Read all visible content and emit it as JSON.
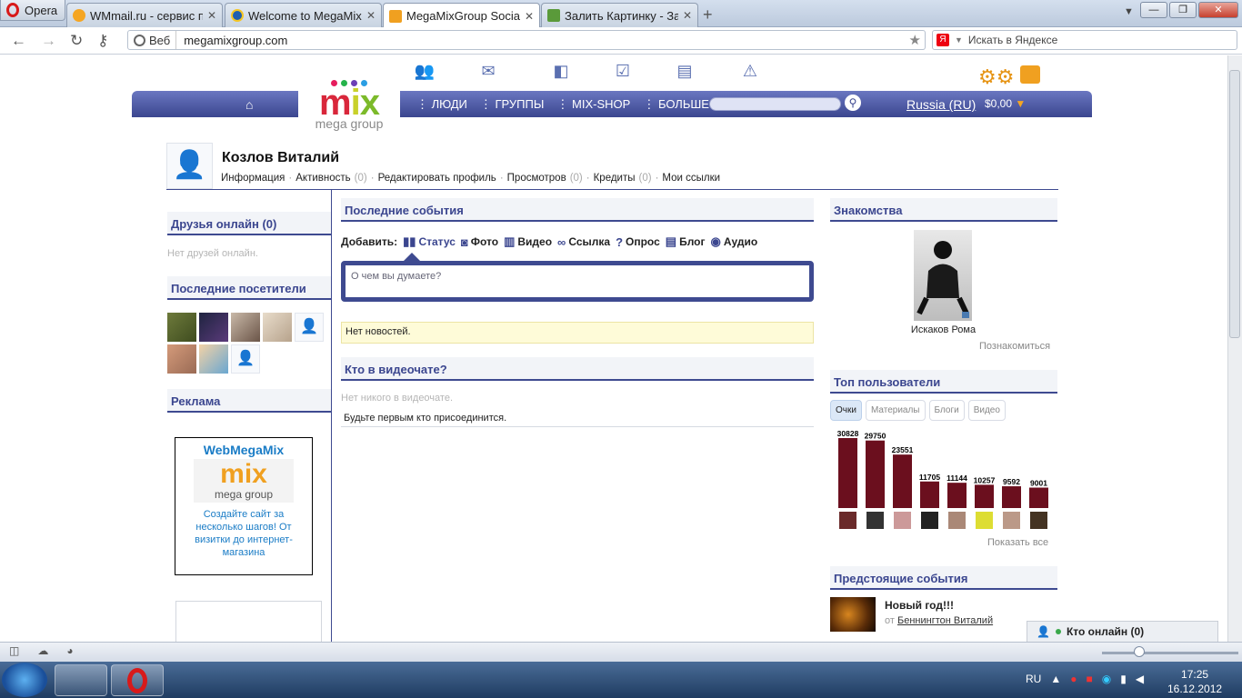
{
  "browser": {
    "menu_label": "Opera",
    "tabs": [
      {
        "title": "WMmail.ru - сервис п...",
        "active": false
      },
      {
        "title": "Welcome to MegaMix...",
        "active": false
      },
      {
        "title": "MegaMixGroup Social ...",
        "active": true
      },
      {
        "title": "Залить Картинку - Заг...",
        "active": false
      }
    ],
    "address": {
      "web_label": "Веб",
      "url": "megamixgroup.com"
    },
    "search_placeholder": "Искать в Яндексе"
  },
  "site": {
    "logo_text": "mix",
    "logo_sub": "mega group",
    "nav": {
      "links": [
        "ЛЮДИ",
        "ГРУППЫ",
        "MIX-SHOP",
        "БОЛЬШЕ"
      ],
      "country": "Russia (RU)",
      "balance": "$0,00"
    }
  },
  "profile": {
    "name": "Козлов Виталий",
    "links": [
      {
        "label": "Информация",
        "count": ""
      },
      {
        "label": "Активность",
        "count": "(0)"
      },
      {
        "label": "Редактировать профиль",
        "count": ""
      },
      {
        "label": "Просмотров",
        "count": "(0)"
      },
      {
        "label": "Кредиты",
        "count": "(0)"
      },
      {
        "label": "Мои ссылки",
        "count": ""
      }
    ]
  },
  "left": {
    "friends_title": "Друзья онлайн (0)",
    "friends_empty": "Нет друзей онлайн.",
    "visitors_title": "Последние посетители",
    "ads_title": "Реклама",
    "ad": {
      "title": "WebMegaMix",
      "logo_text": "mix",
      "logo_sub": "mega group",
      "text": "Создайте сайт за несколько шагов! От визитки до интернет-магазина"
    }
  },
  "center": {
    "events_title": "Последние события",
    "add_label": "Добавить:",
    "add_items": [
      "Статус",
      "Фото",
      "Видео",
      "Ссылка",
      "Опрос",
      "Блог",
      "Аудио"
    ],
    "status_placeholder": "О чем вы думаете?",
    "no_news": "Нет новостей.",
    "videochat_title": "Кто в видеочате?",
    "videochat_empty": "Нет никого в видеочате.",
    "videochat_first": "Будьте первым кто присоединится."
  },
  "right": {
    "dating_title": "Знакомства",
    "dating_name": "Искаков Рома",
    "dating_link": "Познакомиться",
    "top_title": "Топ пользователи",
    "top_tabs": [
      "Очки",
      "Материалы",
      "Блоги",
      "Видео"
    ],
    "show_all": "Показать все",
    "upcoming_title": "Предстоящие события",
    "event": {
      "title": "Новый год!!!",
      "by_prefix": "от",
      "by_name": "Беннингтон Виталий"
    }
  },
  "chart_data": {
    "type": "bar",
    "categories": [
      "1",
      "2",
      "3",
      "4",
      "5",
      "6",
      "7",
      "8"
    ],
    "values": [
      30828,
      29750,
      23551,
      11705,
      11144,
      10257,
      9592,
      9001
    ],
    "title": "",
    "xlabel": "",
    "ylabel": "",
    "ylim": [
      0,
      30828
    ],
    "bar_color": "#6b0f1e"
  },
  "online_bar": "Кто онлайн (0)",
  "taskbar": {
    "lang": "RU",
    "time": "17:25",
    "date": "16.12.2012"
  },
  "colors": {
    "nav": "#3e4a90",
    "accent": "#3b468f",
    "bars": "#6b0f1e"
  }
}
